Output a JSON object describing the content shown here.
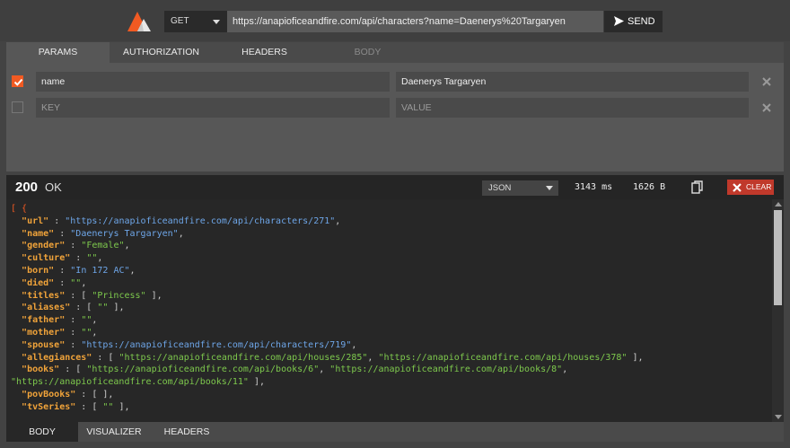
{
  "request": {
    "method": "GET",
    "url": "https://anapioficeandfire.com/api/characters?name=Daenerys%20Targaryen",
    "send_label": "SEND"
  },
  "request_tabs": [
    "PARAMS",
    "AUTHORIZATION",
    "HEADERS",
    "BODY"
  ],
  "params": [
    {
      "enabled": true,
      "key": "name",
      "value": "Daenerys Targaryen"
    },
    {
      "enabled": false,
      "key_placeholder": "KEY",
      "value_placeholder": "VALUE"
    }
  ],
  "response": {
    "status_code": "200",
    "status_text": "OK",
    "format": "JSON",
    "time": "3143 ms",
    "size": "1626 B",
    "clear_label": "CLEAR"
  },
  "response_body": {
    "url": "https://anapioficeandfire.com/api/characters/271",
    "name": "Daenerys Targaryen",
    "gender": "Female",
    "culture": "",
    "born": "In 172 AC",
    "died": "",
    "titles": "Princess",
    "aliases": "",
    "father": "",
    "mother": "",
    "spouse": "https://anapioficeandfire.com/api/characters/719",
    "allegiance_1": "https://anapioficeandfire.com/api/houses/285",
    "allegiance_2": "https://anapioficeandfire.com/api/houses/378",
    "book_1": "https://anapioficeandfire.com/api/books/6",
    "book_2": "https://anapioficeandfire.com/api/books/8",
    "book_3": "https://anapioficeandfire.com/api/books/11",
    "tvSeries": ""
  },
  "bottom_tabs": [
    "BODY",
    "VISUALIZER",
    "HEADERS"
  ],
  "colors": {
    "accent": "#f15a22",
    "clear_button": "#c0392b",
    "json_key": "#f0a33a",
    "json_string": "#7ec94d",
    "json_url": "#6ea6e8"
  },
  "icons": {
    "logo": "mountain-logo-icon",
    "send": "paper-plane-icon",
    "remove": "close-icon",
    "copy": "copy-icon",
    "clear": "close-icon"
  }
}
